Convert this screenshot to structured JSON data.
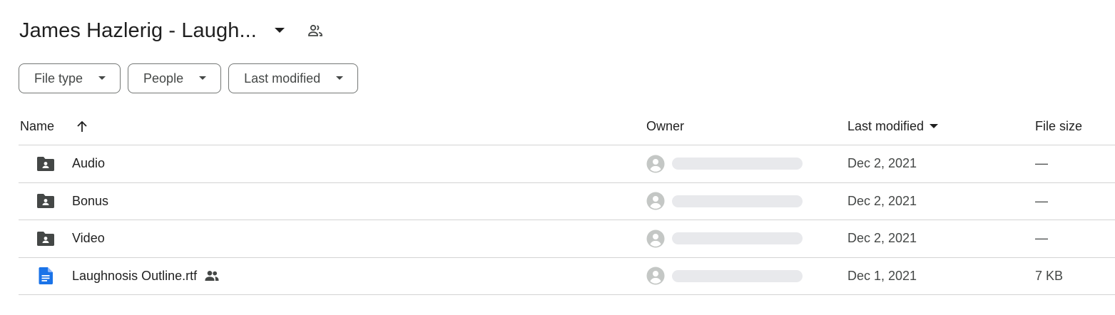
{
  "folder": {
    "title": "James Hazlerig - Laugh...",
    "dropdown_icon": "arrow-drop-down-icon",
    "shared_icon": "people-outline-icon"
  },
  "filters": [
    {
      "label": "File type"
    },
    {
      "label": "People"
    },
    {
      "label": "Last modified"
    }
  ],
  "columns": {
    "name": "Name",
    "owner": "Owner",
    "last_modified": "Last modified",
    "file_size": "File size"
  },
  "rows": [
    {
      "name": "Audio",
      "type": "shared-folder",
      "modified": "Dec 2, 2021",
      "size": "—",
      "shared": false
    },
    {
      "name": "Bonus",
      "type": "shared-folder",
      "modified": "Dec 2, 2021",
      "size": "—",
      "shared": false
    },
    {
      "name": "Video",
      "type": "shared-folder",
      "modified": "Dec 2, 2021",
      "size": "—",
      "shared": false
    },
    {
      "name": "Laughnosis Outline.rtf",
      "type": "docs",
      "modified": "Dec 1, 2021",
      "size": "7 KB",
      "shared": true
    }
  ],
  "colors": {
    "folder_icon": "#444746",
    "docs_icon": "#1a73e8",
    "avatar": "#c4c7c5",
    "owner_placeholder": "#e8e9ec",
    "border": "#d3d3d3"
  }
}
